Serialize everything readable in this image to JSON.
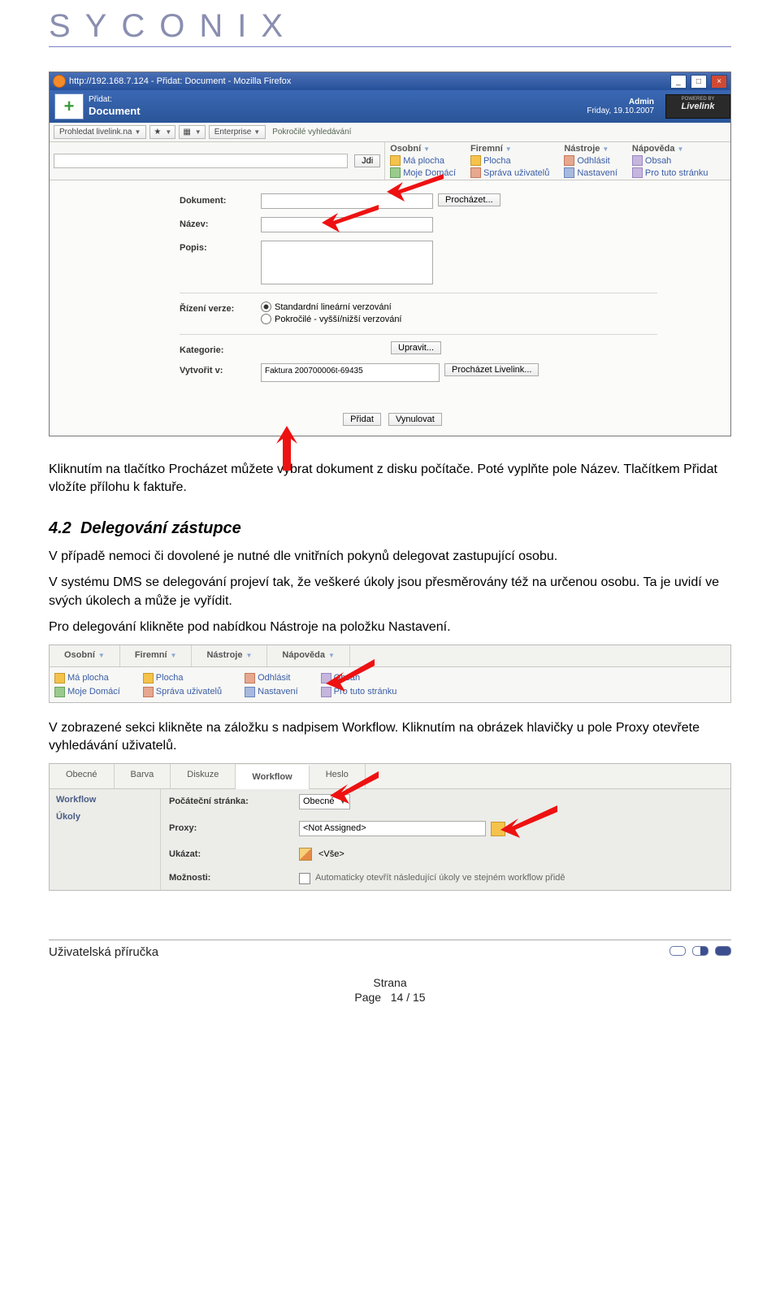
{
  "logo": "SYCONIX",
  "screenshot1": {
    "window_title": "http://192.168.7.124 - Přidat: Document - Mozilla Firefox",
    "appbar_small": "Přidat:",
    "appbar_big": "Document",
    "admin_label": "Admin",
    "date_label": "Friday, 19.10.2007",
    "powered_by": "POWERED BY",
    "livelink": "Livelink",
    "toolbar": {
      "search": "Prohledat livelink.na",
      "enterprise": "Enterprise",
      "advanced": "Pokročilé vyhledávání",
      "jdi": "Jdi"
    },
    "topmenu": {
      "osobni": "Osobní",
      "firemni": "Firemní",
      "nastroje": "Nástroje",
      "napoveda": "Nápověda",
      "ma_plocha": "Má plocha",
      "moje_domaci": "Moje Domácí",
      "plocha": "Plocha",
      "sprava": "Správa uživatelů",
      "odhlasit": "Odhlásit",
      "nastaveni": "Nastavení",
      "obsah": "Obsah",
      "pro_tuto": "Pro tuto stránku"
    },
    "form": {
      "dokument": "Dokument:",
      "prochazet": "Procházet...",
      "nazev": "Název:",
      "popis": "Popis:",
      "rizeni": "Řízení verze:",
      "radio1": "Standardní lineární verzování",
      "radio2": "Pokročilé - vyšší/nižší verzování",
      "kategorie": "Kategorie:",
      "upravit": "Upravit...",
      "vytvořit": "Vytvořit v:",
      "vytvorit_val": "Faktura 200700006t-69435",
      "browse_livelink": "Procházet Livelink...",
      "pridat": "Přidat",
      "vynulovat": "Vynulovat"
    }
  },
  "body": {
    "p1": "Kliknutím na tlačítko Procházet můžete vybrat dokument z disku počítače. Poté vyplňte pole Název. Tlačítkem Přidat vložíte přílohu k faktuře.",
    "h2_num": "4.2",
    "h2_title": "Delegování zástupce",
    "p2": "V případě nemoci či dovolené je nutné dle vnitřních pokynů delegovat zastupující osobu.",
    "p3": "V systému DMS se delegování projeví tak, že veškeré úkoly jsou přesměrovány též na určenou osobu. Ta je uvidí ve svých úkolech a může je vyřídit.",
    "p4": "Pro delegování klikněte pod nabídkou Nástroje na položku Nastavení.",
    "p5": "V zobrazené sekci klikněte na záložku s nadpisem Workflow. Kliknutím na obrázek hlavičky u pole Proxy otevřete vyhledávání uživatelů."
  },
  "smallshot": {
    "osobni": "Osobní",
    "firemni": "Firemní",
    "nastroje": "Nástroje",
    "napoveda": "Nápověda",
    "ma_plocha": "Má plocha",
    "moje_domaci": "Moje Domácí",
    "plocha": "Plocha",
    "sprava": "Správa uživatelů",
    "odhlasit": "Odhlásit",
    "nastaveni": "Nastavení",
    "obsah": "Obsah",
    "pro_tuto": "Pro tuto stránku"
  },
  "wfshot": {
    "tabs": {
      "obec": "Obecné",
      "barva": "Barva",
      "diskuze": "Diskuze",
      "workflow": "Workflow",
      "heslo": "Heslo"
    },
    "side": {
      "workflow": "Workflow",
      "ukoly": "Úkoly"
    },
    "rows": {
      "pocatecni": "Počáteční stránka:",
      "pocatecni_val": "Obecné",
      "proxy": "Proxy:",
      "proxy_val": "<Not Assigned>",
      "ukazat": "Ukázat:",
      "ukazat_val": "<Vše>",
      "moznosti": "Možnosti:",
      "moznosti_txt": "Automaticky otevřít následující úkoly ve stejném workflow přidě"
    }
  },
  "footer": {
    "left": "Uživatelská příručka",
    "strana": "Strana",
    "page": "Page",
    "num": "14 / 15"
  }
}
